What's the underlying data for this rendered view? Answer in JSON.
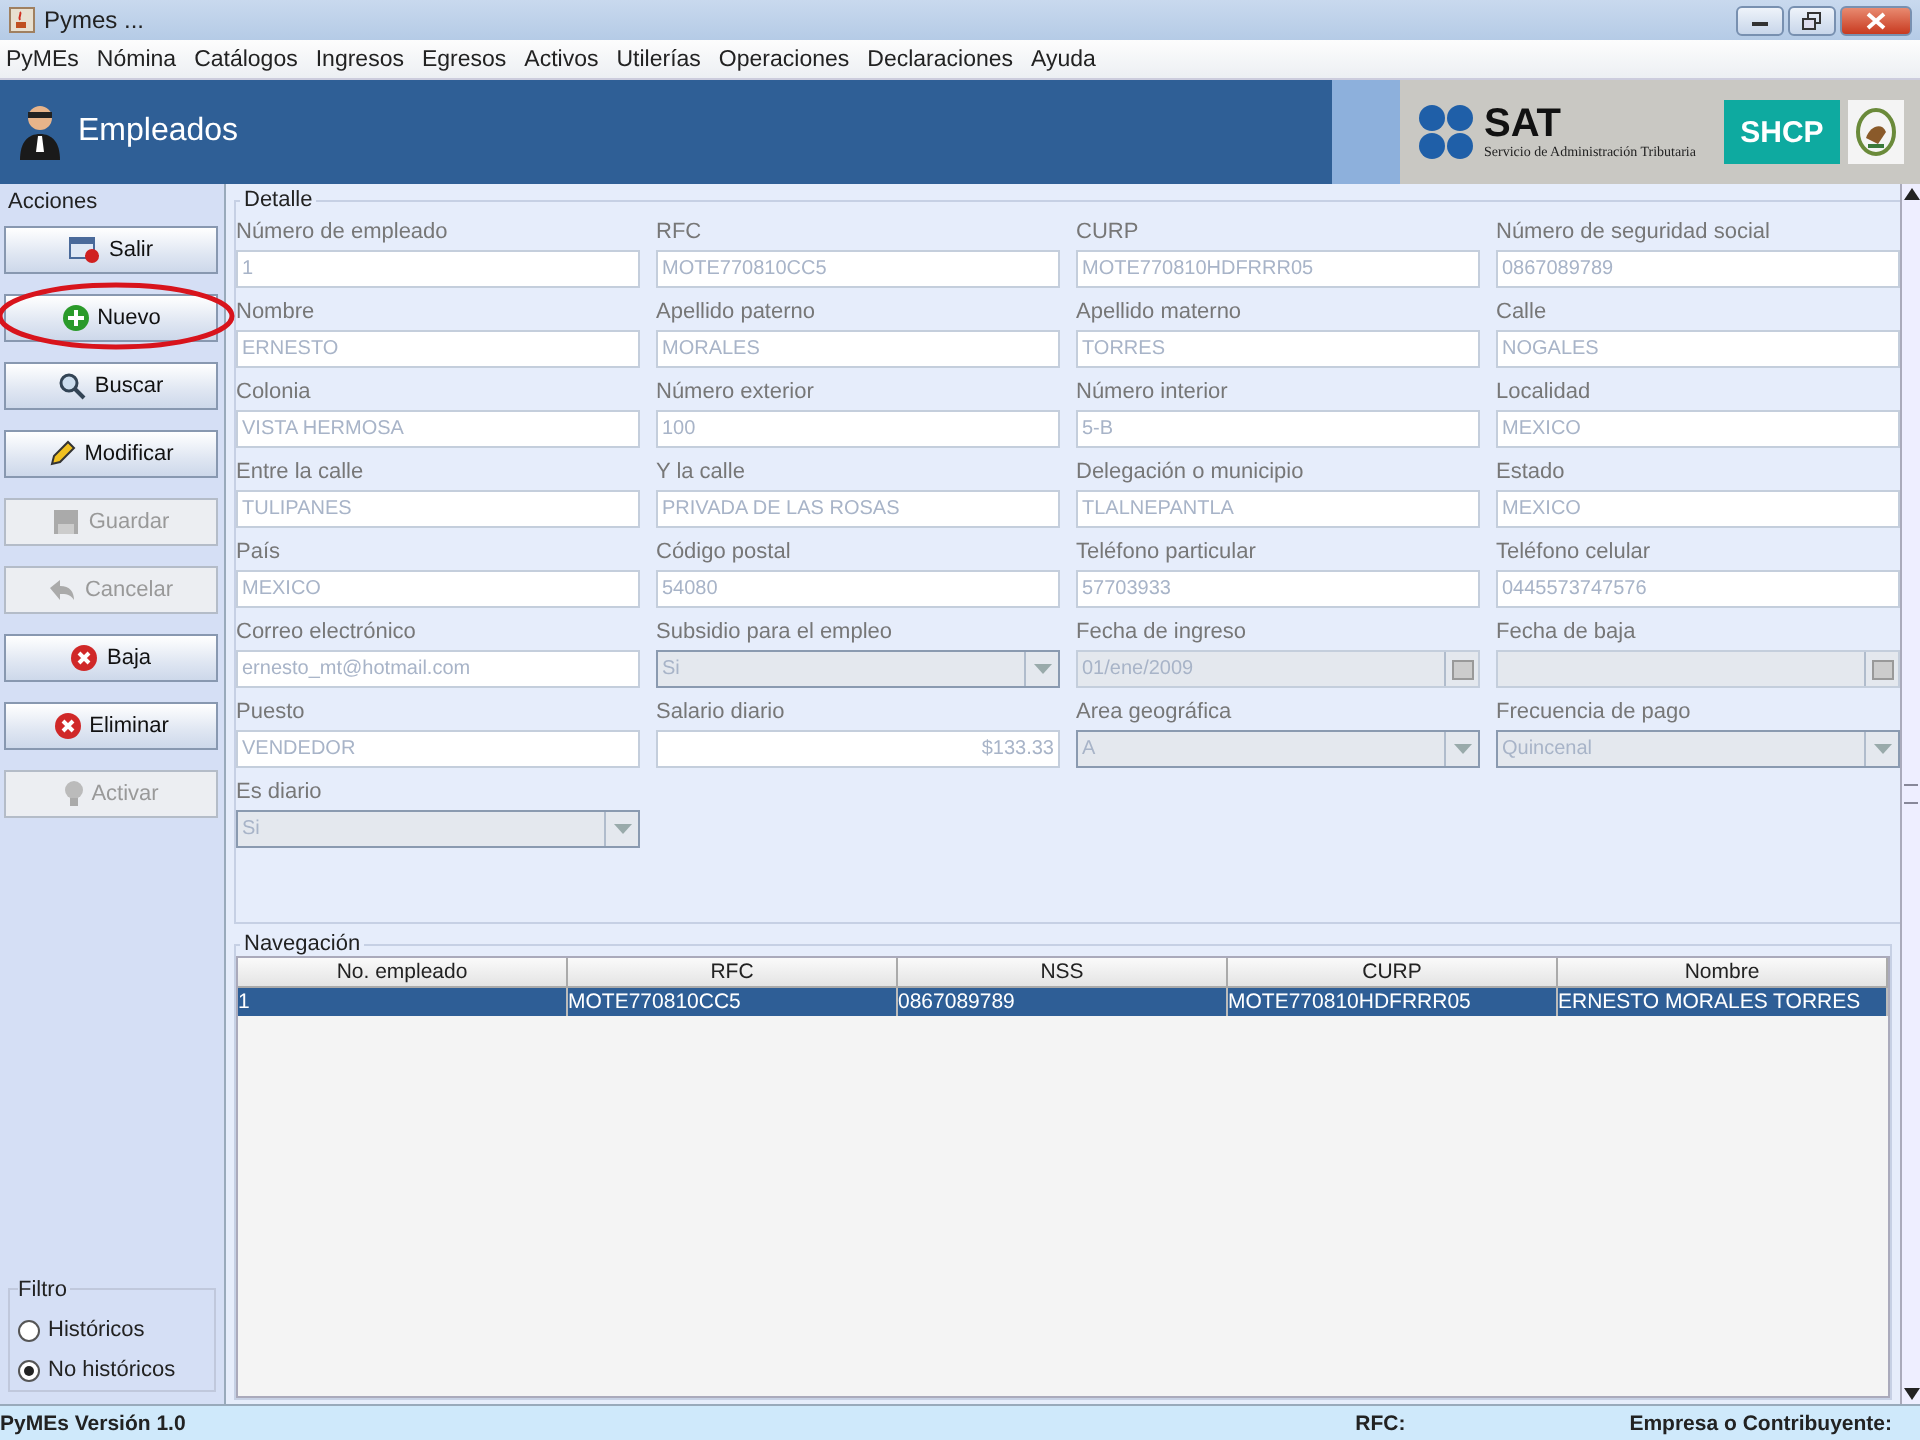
{
  "window": {
    "title": "Pymes ..."
  },
  "menu": [
    {
      "label": "PyMEs"
    },
    {
      "label": "Nómina"
    },
    {
      "label": "Catálogos"
    },
    {
      "label": "Ingresos"
    },
    {
      "label": "Egresos"
    },
    {
      "label": "Activos"
    },
    {
      "label": "Utilerías"
    },
    {
      "label": "Operaciones"
    },
    {
      "label": "Declaraciones"
    },
    {
      "label": "Ayuda"
    }
  ],
  "header": {
    "title": "Empleados",
    "sat_logo": "SAT",
    "sat_name": "Servicio de Administración Tributaria",
    "shcp_logo": "SHCP"
  },
  "actions": {
    "title": "Acciones",
    "buttons": [
      {
        "label": "Salir",
        "kind": "exit",
        "disabled": false,
        "highlighted": false
      },
      {
        "label": "Nuevo",
        "kind": "add",
        "disabled": false,
        "highlighted": true
      },
      {
        "label": "Buscar",
        "kind": "search",
        "disabled": false,
        "highlighted": false
      },
      {
        "label": "Modificar",
        "kind": "edit",
        "disabled": false,
        "highlighted": false
      },
      {
        "label": "Guardar",
        "kind": "save",
        "disabled": true,
        "highlighted": false
      },
      {
        "label": "Cancelar",
        "kind": "undo",
        "disabled": true,
        "highlighted": false
      },
      {
        "label": "Baja",
        "kind": "delete",
        "disabled": false,
        "highlighted": false
      },
      {
        "label": "Eliminar",
        "kind": "delete",
        "disabled": false,
        "highlighted": false
      },
      {
        "label": "Activar",
        "kind": "activate",
        "disabled": true,
        "highlighted": false
      }
    ]
  },
  "filter": {
    "title": "Filtro",
    "options": [
      {
        "label": "Históricos",
        "selected": false
      },
      {
        "label": "No históricos",
        "selected": true
      }
    ]
  },
  "detail": {
    "title": "Detalle",
    "fields": [
      {
        "label": "Número de empleado",
        "value": "1",
        "kind": "text"
      },
      {
        "label": "RFC",
        "value": "MOTE770810CC5",
        "kind": "text"
      },
      {
        "label": "CURP",
        "value": "MOTE770810HDFRRR05",
        "kind": "text"
      },
      {
        "label": "Número de seguridad social",
        "value": "0867089789",
        "kind": "text"
      },
      {
        "label": "Nombre",
        "value": "ERNESTO",
        "kind": "text"
      },
      {
        "label": "Apellido paterno",
        "value": "MORALES",
        "kind": "text"
      },
      {
        "label": "Apellido materno",
        "value": "TORRES",
        "kind": "text"
      },
      {
        "label": "Calle",
        "value": "NOGALES",
        "kind": "text"
      },
      {
        "label": "Colonia",
        "value": "VISTA HERMOSA",
        "kind": "text"
      },
      {
        "label": "Número exterior",
        "value": "100",
        "kind": "text"
      },
      {
        "label": "Número interior",
        "value": "5-B",
        "kind": "text"
      },
      {
        "label": "Localidad",
        "value": "MEXICO",
        "kind": "text"
      },
      {
        "label": "Entre la calle",
        "value": "TULIPANES",
        "kind": "text"
      },
      {
        "label": "Y la calle",
        "value": "PRIVADA DE LAS ROSAS",
        "kind": "text"
      },
      {
        "label": "Delegación o municipio",
        "value": "TLALNEPANTLA",
        "kind": "text"
      },
      {
        "label": "Estado",
        "value": "MEXICO",
        "kind": "text"
      },
      {
        "label": "País",
        "value": "MEXICO",
        "kind": "text"
      },
      {
        "label": "Código postal",
        "value": "54080",
        "kind": "text"
      },
      {
        "label": "Teléfono particular",
        "value": "57703933",
        "kind": "text"
      },
      {
        "label": "Teléfono celular",
        "value": "0445573747576",
        "kind": "text"
      },
      {
        "label": "Correo electrónico",
        "value": "ernesto_mt@hotmail.com",
        "kind": "text"
      },
      {
        "label": "Subsidio para el empleo",
        "value": "Si",
        "kind": "combo"
      },
      {
        "label": "Fecha de ingreso",
        "value": "01/ene/2009",
        "kind": "date"
      },
      {
        "label": "Fecha de baja",
        "kind": "date"
      },
      {
        "label": "Puesto",
        "value": "VENDEDOR",
        "kind": "text"
      },
      {
        "label": "Salario diario",
        "value": "$133.33",
        "kind": "amount"
      },
      {
        "label": "Area geográfica",
        "value": "A",
        "kind": "combo"
      },
      {
        "label": "Frecuencia de pago",
        "value": "Quincenal",
        "kind": "combo"
      },
      {
        "label": "Es diario",
        "value": "Si",
        "kind": "combo"
      }
    ]
  },
  "navigation": {
    "title": "Navegación",
    "columns": [
      "No. empleado",
      "RFC",
      "NSS",
      "CURP",
      "Nombre"
    ],
    "rows": [
      {
        "cells": [
          "1",
          "MOTE770810CC5",
          "0867089789",
          "MOTE770810HDFRRR05",
          "ERNESTO MORALES TORRES"
        ],
        "selected": true
      }
    ]
  },
  "status_bar": {
    "version": "PyMEs Versión 1.0",
    "rfc_label": "RFC:",
    "company_label": "Empresa o Contribuyente:"
  }
}
